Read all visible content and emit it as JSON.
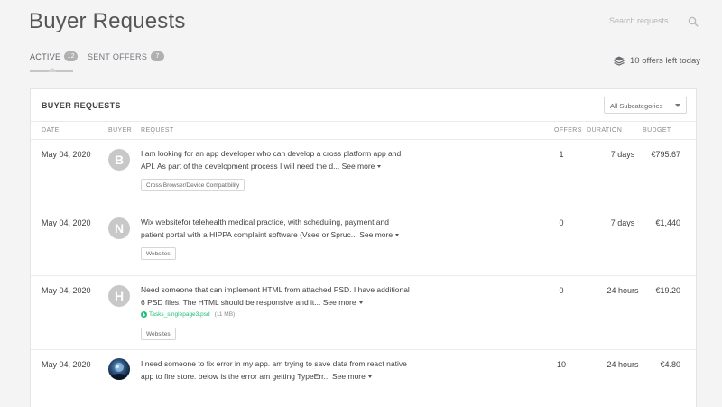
{
  "page": {
    "title": "Buyer Requests",
    "search_placeholder": "Search requests"
  },
  "tabs": [
    {
      "label": "ACTIVE",
      "count": "12"
    },
    {
      "label": "SENT OFFERS",
      "count": "7"
    }
  ],
  "offers_left": "10 offers left today",
  "card": {
    "title": "BUYER REQUESTS",
    "subcategory_select": "All Subcategories"
  },
  "columns": {
    "date": "DATE",
    "buyer": "BUYER",
    "request": "REQUEST",
    "offers": "OFFERS",
    "duration": "DURATION",
    "budget": "BUDGET"
  },
  "see_more_label": "See more",
  "requests": [
    {
      "date": "May 04, 2020",
      "avatar_initial": "B",
      "text": "I am looking for an app developer who can develop a cross platform app and API. As part of the development process I will need the d...",
      "tag": "Cross Browser/Device Compatibility",
      "offers": "1",
      "duration": "7 days",
      "budget": "€795.67"
    },
    {
      "date": "May 04, 2020",
      "avatar_initial": "N",
      "text": "Wix websitefor telehealth medical practice, with scheduling, payment and patient portal with a HIPPA complaint software (Vsee or Spruc...",
      "tag": "Websites",
      "offers": "0",
      "duration": "7 days",
      "budget": "€1,440"
    },
    {
      "date": "May 04, 2020",
      "avatar_initial": "H",
      "text": "Need someone that can implement HTML from attached PSD. I have additional 6 PSD files. The HTML should be responsive and it...",
      "attachment_name": "Tasks_singlepage3.psd",
      "attachment_size": "(11 MB)",
      "tag": "Websites",
      "offers": "0",
      "duration": "24 hours",
      "budget": "€19.20"
    },
    {
      "date": "May 04, 2020",
      "avatar_initial": "",
      "text": "I need someone to fix error in my app. am trying to save data from react native app to fire store. below is the error am getting TypeErr...",
      "offers": "10",
      "duration": "24 hours",
      "budget": "€4.80"
    }
  ],
  "colors": {
    "background": "#f4f4f4",
    "card": "#ffffff",
    "text": "#404145",
    "muted": "#8a8b90",
    "attachment": "#1dbf73",
    "avatar": "#c8c8c8"
  },
  "icons": {
    "search": "search-icon",
    "offers_left": "stack-icon",
    "attachment": "download-circle-icon",
    "dropdown": "chevron-down-icon"
  }
}
